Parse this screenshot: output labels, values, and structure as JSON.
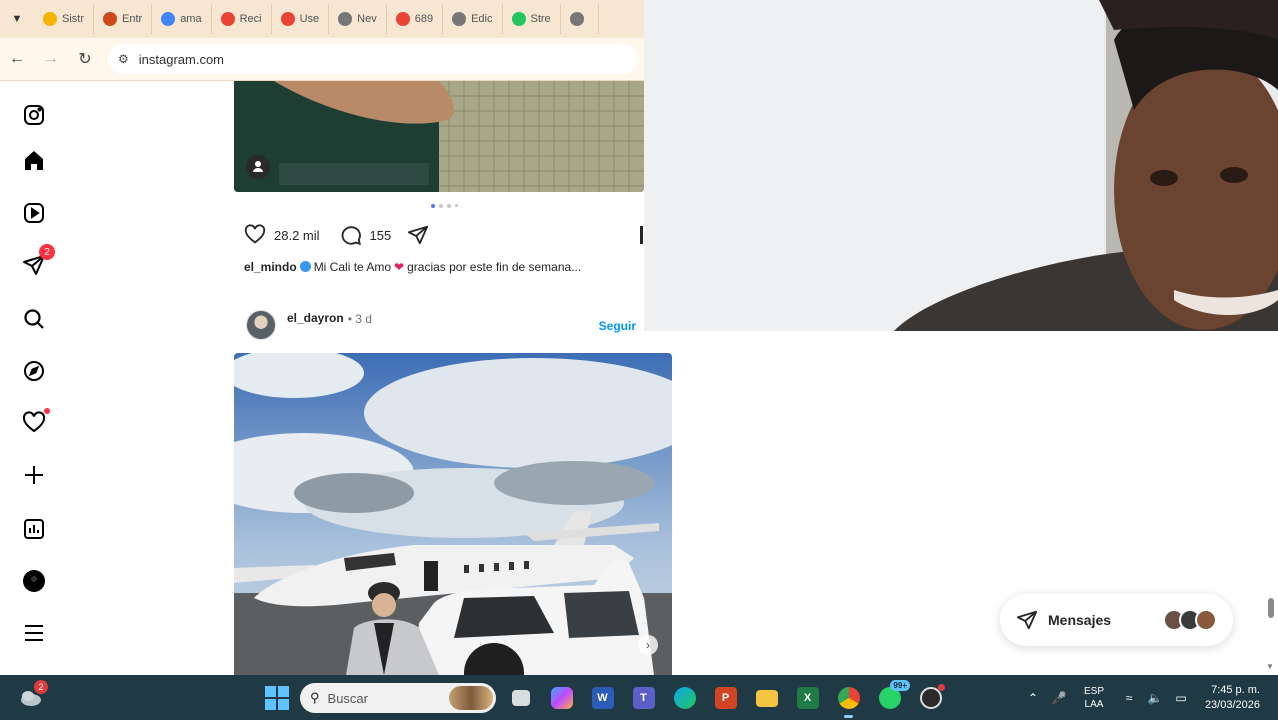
{
  "browser": {
    "tabs": [
      {
        "label": "Sistr",
        "icon": "google-play-icon",
        "color": "#f4b400"
      },
      {
        "label": "Entr",
        "icon": "myjob-icon",
        "color": "#cc4a1c"
      },
      {
        "label": "ama",
        "icon": "google-icon",
        "color": "#4285f4"
      },
      {
        "label": "Reci",
        "icon": "gmail-icon",
        "color": "#ea4335"
      },
      {
        "label": "Use",
        "icon": "gmail-icon",
        "color": "#ea4335"
      },
      {
        "label": "Nev",
        "icon": "globe-icon",
        "color": "#777777"
      },
      {
        "label": "689",
        "icon": "gmail-icon",
        "color": "#ea4335"
      },
      {
        "label": "Edic",
        "icon": "globe-icon",
        "color": "#777777"
      },
      {
        "label": "Stre",
        "icon": "kick-icon",
        "color": "#22c55e"
      },
      {
        "label": "",
        "icon": "globe-icon",
        "color": "#777777"
      }
    ],
    "url": "instagram.com"
  },
  "instagram": {
    "nav_badge_count": "2",
    "post1": {
      "likes": "28.2 mil",
      "comments": "155",
      "caption_user": "el_mindo",
      "caption_text": "Mi Cali te Amo",
      "caption_rest": "gracias por este fin de semana..."
    },
    "post2": {
      "user": "el_dayron",
      "time": "• 3 d",
      "follow": "Seguir"
    },
    "messages_label": "Mensajes"
  },
  "taskbar": {
    "weather_badge": "2",
    "search_placeholder": "Buscar",
    "whatsapp_badge": "99+",
    "lang_top": "ESP",
    "lang_bottom": "LAA",
    "time": "7:45 p. m.",
    "date": "23/03/2026"
  },
  "colors": {
    "instagram_blue": "#0095f6",
    "notification_red": "#ff3040",
    "taskbar": "#1f3a44"
  }
}
